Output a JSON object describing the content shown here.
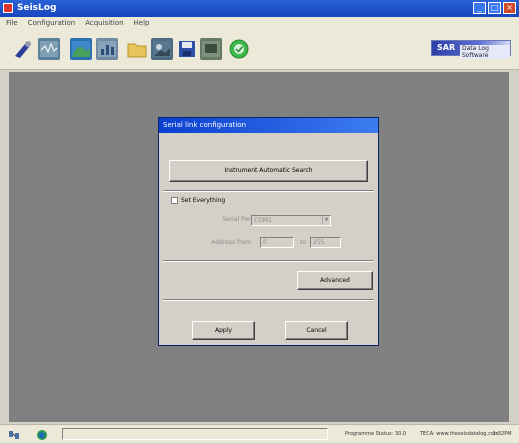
{
  "window": {
    "title": "SeisLog"
  },
  "menu": [
    "File",
    "Configuration",
    "Acquisition",
    "Help"
  ],
  "toolbar": {
    "buttons": [
      {
        "name": "probe-icon",
        "color": "#2c3e9a"
      },
      {
        "name": "seismograph-icon",
        "color": "#5a7f9a"
      },
      {
        "name": "earth-map-icon",
        "color": "#2e6fb0"
      },
      {
        "name": "chart-icon",
        "color": "#6f8aa3"
      },
      {
        "name": "folder-icon",
        "color": "#e8c45a"
      },
      {
        "name": "photo-icon",
        "color": "#4d6b80"
      },
      {
        "name": "save-icon",
        "color": "#2c4fa8"
      },
      {
        "name": "monitor-icon",
        "color": "#667a66"
      },
      {
        "name": "check-circle-icon",
        "color": "#3db84a"
      }
    ],
    "brand": {
      "prefix": "SAR",
      "name": "Data Log Software"
    }
  },
  "dialog": {
    "title": "Serial link configuration",
    "auto_search_label": "Instrument Automatic Search",
    "set_everything_label": "Set Everything",
    "serial_port_label": "Serial Port",
    "serial_port_value": "COM1",
    "address_label": "Address from",
    "to_label": "to",
    "address_from": "0",
    "address_to": "255",
    "advanced_label": "Advanced",
    "apply_label": "Apply",
    "cancel_label": "Cancel"
  },
  "status": {
    "version": "Programme Status: 30.0",
    "company": "TECA: www.theseisdatalog.com",
    "time": "1:32PM"
  }
}
